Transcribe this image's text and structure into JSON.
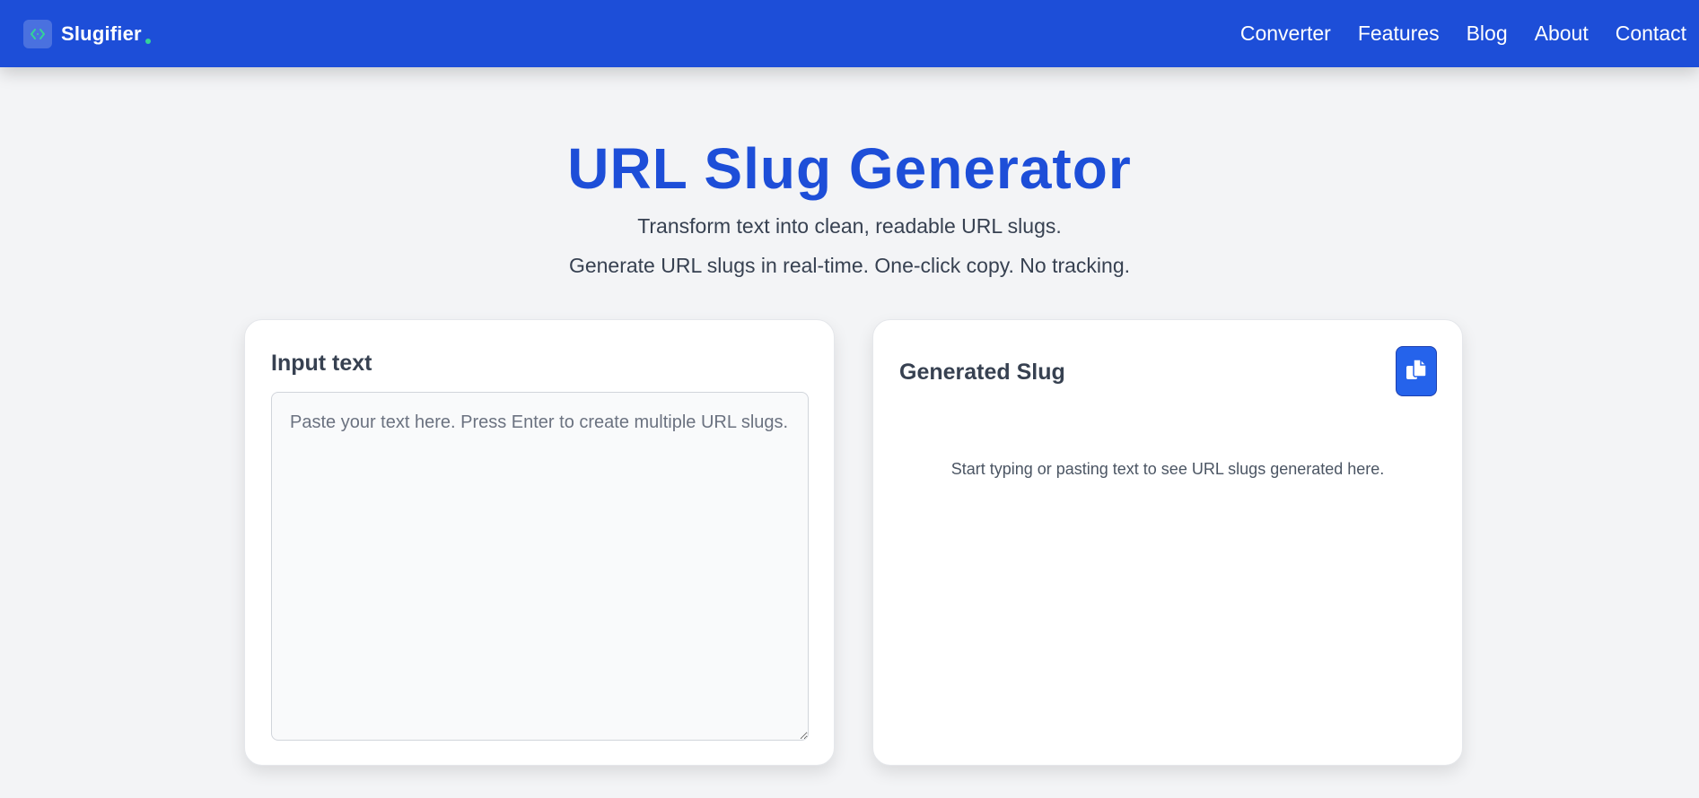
{
  "brand": {
    "name": "Slugifier",
    "logo_icon": "code-brackets-icon",
    "accent": "#34d399"
  },
  "nav": {
    "items": [
      {
        "label": "Converter"
      },
      {
        "label": "Features"
      },
      {
        "label": "Blog"
      },
      {
        "label": "About"
      },
      {
        "label": "Contact"
      }
    ]
  },
  "hero": {
    "title": "URL Slug Generator",
    "subtitle1": "Transform text into clean, readable URL slugs.",
    "subtitle2": "Generate URL slugs in real-time. One-click copy. No tracking."
  },
  "input_card": {
    "heading": "Input text",
    "placeholder": "Paste your text here. Press Enter to create multiple URL slugs.",
    "value": ""
  },
  "output_card": {
    "heading": "Generated Slug",
    "copy_icon": "copy-icon",
    "empty_message": "Start typing or pasting text to see URL slugs generated here."
  },
  "colors": {
    "primary": "#1d4ed8",
    "button": "#2563eb",
    "background": "#f3f4f6"
  }
}
